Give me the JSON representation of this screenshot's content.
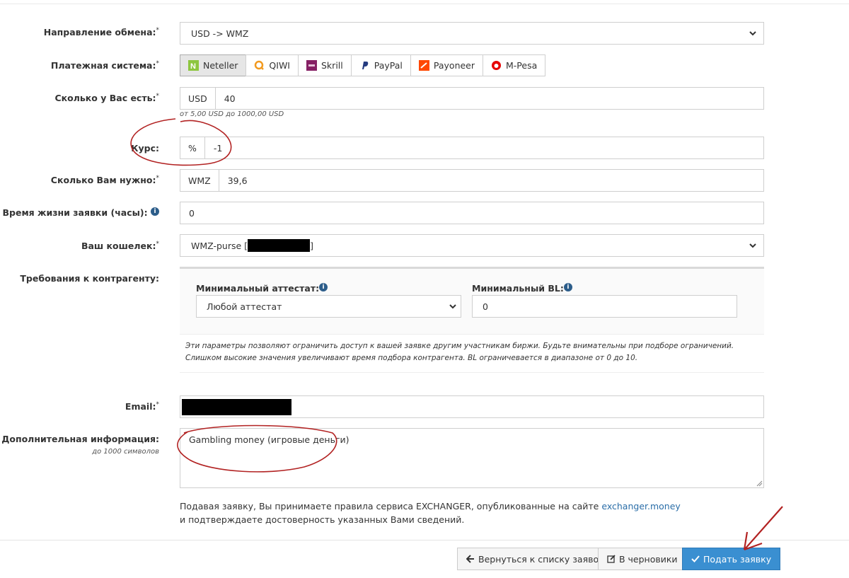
{
  "form": {
    "direction": {
      "label": "Направление обмена:",
      "req": "*",
      "value": "USD -> WMZ"
    },
    "payment": {
      "label": "Платежная система:",
      "req": "*",
      "options": [
        {
          "label": "Neteller",
          "icon": "neteller-icon"
        },
        {
          "label": "QIWI",
          "icon": "qiwi-icon"
        },
        {
          "label": "Skrill",
          "icon": "skrill-icon"
        },
        {
          "label": "PayPal",
          "icon": "paypal-icon"
        },
        {
          "label": "Payoneer",
          "icon": "payoneer-icon"
        },
        {
          "label": "M-Pesa",
          "icon": "mpesa-icon"
        }
      ],
      "selected": "Neteller"
    },
    "have": {
      "label": "Сколько у Вас есть:",
      "req": "*",
      "currency": "USD",
      "value": "40",
      "hint": "от 5,00 USD до 1000,00 USD"
    },
    "rate": {
      "label": "Курс:",
      "unit": "%",
      "value": "-1"
    },
    "need": {
      "label": "Сколько Вам нужно:",
      "req": "*",
      "currency": "WMZ",
      "value": "39,6"
    },
    "lifetime": {
      "label": "Время жизни заявки (часы):",
      "value": "0",
      "info": "i"
    },
    "wallet": {
      "label": "Ваш кошелек:",
      "req": "*",
      "value_prefix": "WMZ-purse [",
      "value_suffix": "]"
    },
    "requirements": {
      "label": "Требования к контрагенту:",
      "min_attestat_label": "Минимальный аттестат:",
      "min_attestat_value": "Любой аттестат",
      "min_bl_label": "Минимальный BL:",
      "min_bl_value": "0",
      "note": "Эти параметры позволяют ограничить доступ к вашей заявке другим участникам биржи. Будьте внимательны при подборе ограничений. Слишком высокие значения увеличивают время подбора контрагента. BL ограничевается в диапазоне от 0 до 10."
    },
    "email": {
      "label": "Email:",
      "req": "*"
    },
    "extra": {
      "label": "Дополнительная информация:",
      "sublabel": "до 1000 символов",
      "value": "Gambling money (игровые деньги)"
    },
    "terms": {
      "line1": "Подавая заявку, Вы принимаете правила сервиса EXCHANGER, опубликованные на сайте ",
      "link": "exchanger.money",
      "line2": "и подтверждаете достоверность указанных Вами сведений."
    }
  },
  "buttons": {
    "back": "Вернуться к списку заявок",
    "drafts": "В черновики",
    "submit": "Подать заявку"
  },
  "colors": {
    "primary": "#3a8fd1",
    "link": "#2b6ea8",
    "annotation": "#b22222"
  }
}
